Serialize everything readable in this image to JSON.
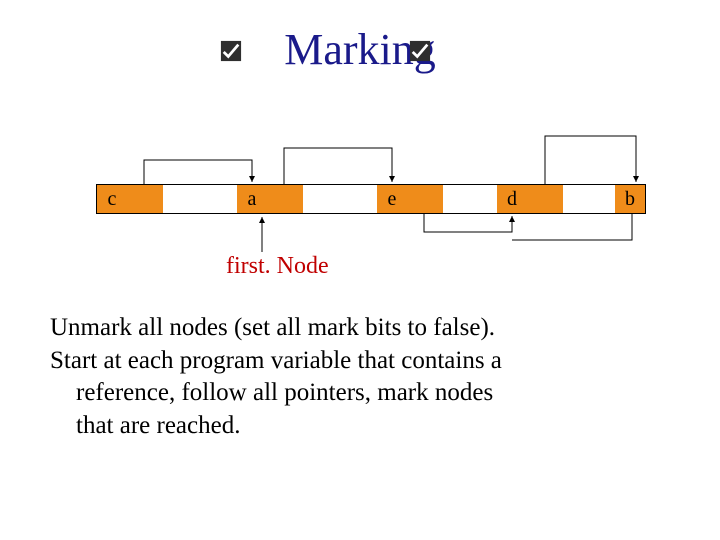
{
  "title": "Marking",
  "cells": {
    "c": "c",
    "a": "a",
    "e": "e",
    "d": "d",
    "b": "b"
  },
  "firstNode": "first. Node",
  "paragraphs": {
    "p1": "Unmark all nodes (set all mark bits to false).",
    "p2_l1": "Start at each program variable that contains a",
    "p2_l2": "reference, follow all pointers, mark nodes",
    "p2_l3": "that are reached."
  },
  "chart_data": {
    "type": "diagram",
    "title": "Marking",
    "nodes": [
      "c",
      "a",
      "e",
      "d",
      "b"
    ],
    "marked": [
      "c",
      "a"
    ],
    "pointers": [
      {
        "from": "c",
        "to": "a"
      },
      {
        "from": "a",
        "to": "e"
      },
      {
        "from": "e",
        "to": "d"
      },
      {
        "from": "d",
        "to": "b"
      },
      {
        "from": "b",
        "to": "d"
      },
      {
        "from": "firstNode",
        "to": "a"
      }
    ],
    "annotations": [
      "first. Node"
    ],
    "body_text": "Unmark all nodes (set all mark bits to false). Start at each program variable that contains a reference, follow all pointers, mark nodes that are reached."
  }
}
